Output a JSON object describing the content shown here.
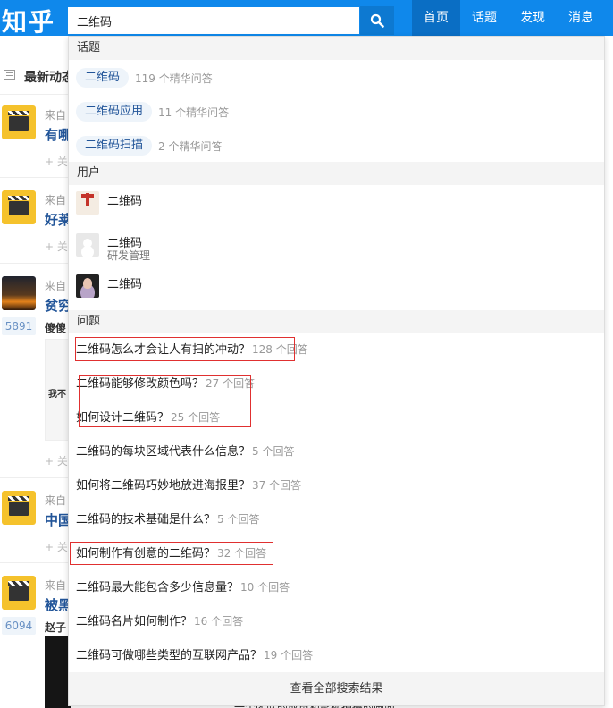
{
  "header": {
    "logo": "知乎",
    "search_value": "二维码",
    "search_icon": "search-icon",
    "nav": [
      "首页",
      "话题",
      "发现",
      "消息"
    ],
    "accent": "#0f88eb"
  },
  "feed": {
    "heading": "最新动态",
    "items": [
      {
        "source": "来自",
        "title": "有哪",
        "action": "+ 关"
      },
      {
        "source": "来自",
        "title": "好莱",
        "action": "+ 关"
      },
      {
        "source": "来自",
        "title": "贫穷",
        "votes": "5891",
        "answer_name": "傻傻",
        "snippet": "我不",
        "action": "+ 关"
      },
      {
        "source": "来自",
        "title": "中国",
        "action": "+ 关"
      },
      {
        "source": "来自",
        "title": "被黑",
        "votes": "6094",
        "answer_name": "赵子"
      }
    ],
    "bottom_text": "一个团队的成员和影视拍摄的画面"
  },
  "dropdown": {
    "topics_header": "话题",
    "topics": [
      {
        "name": "二维码",
        "count": "119 个精华问答"
      },
      {
        "name": "二维码应用",
        "count": "11 个精华问答"
      },
      {
        "name": "二维码扫描",
        "count": "2 个精华问答"
      }
    ],
    "users_header": "用户",
    "users": [
      {
        "name": "二维码",
        "sub": ""
      },
      {
        "name": "二维码",
        "sub": "研发管理"
      },
      {
        "name": "二维码",
        "sub": ""
      }
    ],
    "questions_header": "问题",
    "questions": [
      {
        "title": "二维码怎么才会让人有扫的冲动？",
        "count": "128 个回答"
      },
      {
        "title": "二维码能够修改颜色吗？",
        "count": "27 个回答"
      },
      {
        "title": "如何设计二维码？",
        "count": "25 个回答"
      },
      {
        "title": "二维码的每块区域代表什么信息？",
        "count": "5 个回答"
      },
      {
        "title": "如何将二维码巧妙地放进海报里？",
        "count": "37 个回答"
      },
      {
        "title": "二维码的技术基础是什么？",
        "count": "5 个回答"
      },
      {
        "title": "如何制作有创意的二维码？",
        "count": "32 个回答"
      },
      {
        "title": "二维码最大能包含多少信息量？",
        "count": "10 个回答"
      },
      {
        "title": "二维码名片如何制作？",
        "count": "16 个回答"
      },
      {
        "title": "二维码可做哪些类型的互联网产品？",
        "count": "19 个回答"
      }
    ],
    "footer": "查看全部搜索结果"
  }
}
